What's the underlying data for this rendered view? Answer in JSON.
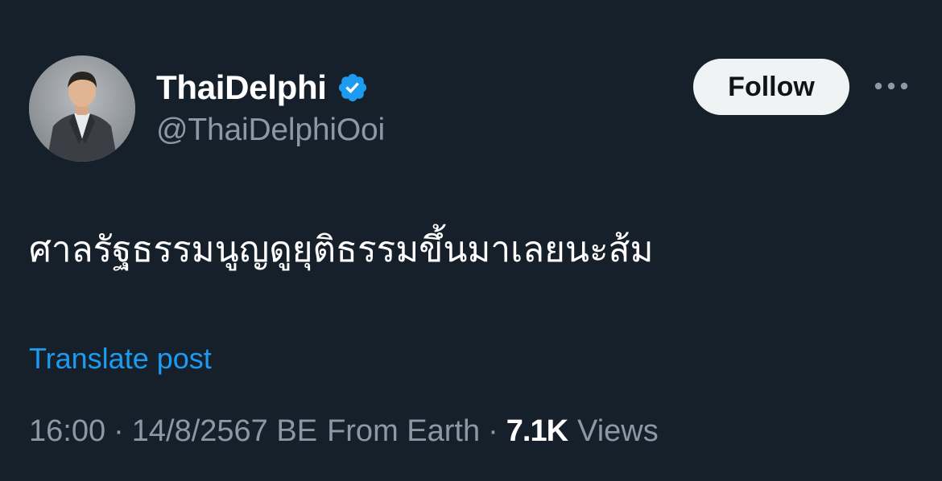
{
  "author": {
    "display_name": "ThaiDelphi",
    "handle": "@ThaiDelphiOoi",
    "verified": true,
    "avatar_icon": "profile-photo"
  },
  "actions": {
    "follow_label": "Follow",
    "more_icon": "more-horizontal-icon"
  },
  "post": {
    "text": "ศาลรัฐธรรมนูญดูยุติธรรมขึ้นมาเลยนะส้ม",
    "translate_label": "Translate post"
  },
  "meta": {
    "time": "16:00",
    "separator": "·",
    "date": "14/8/2567 BE",
    "source": "From Earth",
    "views_count": "7.1K",
    "views_label": "Views"
  },
  "colors": {
    "background": "#15202b",
    "primary_text": "#ffffff",
    "secondary_text": "#8b98a5",
    "link": "#1d9bf0",
    "verified_badge": "#1d9bf0",
    "follow_button_bg": "#eff3f4"
  }
}
